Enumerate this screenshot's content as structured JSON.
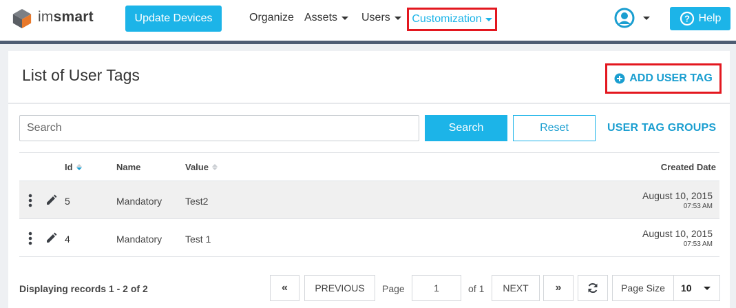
{
  "header": {
    "logo_text_light": "im",
    "logo_text_bold": "smart",
    "update_button": "Update Devices",
    "nav": [
      {
        "label": "Organize",
        "has_caret": false
      },
      {
        "label": "Assets",
        "has_caret": true
      },
      {
        "label": "Users",
        "has_caret": true
      }
    ],
    "customization": "Customization",
    "user_icon": "user-circle-icon",
    "help_button": "Help",
    "accent_color": "#1cb4e8",
    "highlight_color": "#e3171f"
  },
  "page": {
    "title": "List of User Tags",
    "add_button": "ADD USER TAG"
  },
  "search": {
    "placeholder": "Search",
    "value": "",
    "search_button": "Search",
    "reset_button": "Reset",
    "groups_link": "USER TAG GROUPS"
  },
  "table": {
    "columns": {
      "id": "Id",
      "name": "Name",
      "value": "Value",
      "created": "Created Date"
    },
    "rows": [
      {
        "id": "5",
        "name": "Mandatory",
        "value": "Test2",
        "date": "August 10, 2015",
        "time": "07:53 AM"
      },
      {
        "id": "4",
        "name": "Mandatory",
        "value": "Test 1",
        "date": "August 10, 2015",
        "time": "07:53 AM"
      }
    ]
  },
  "pagination": {
    "records": "Displaying records 1 - 2 of 2",
    "first": "«",
    "previous": "PREVIOUS",
    "page_label": "Page",
    "page_value": "1",
    "of_label": "of 1",
    "next": "NEXT",
    "last": "»",
    "refresh_icon": "refresh-icon",
    "page_size_label": "Page Size",
    "page_size_value": "10"
  }
}
